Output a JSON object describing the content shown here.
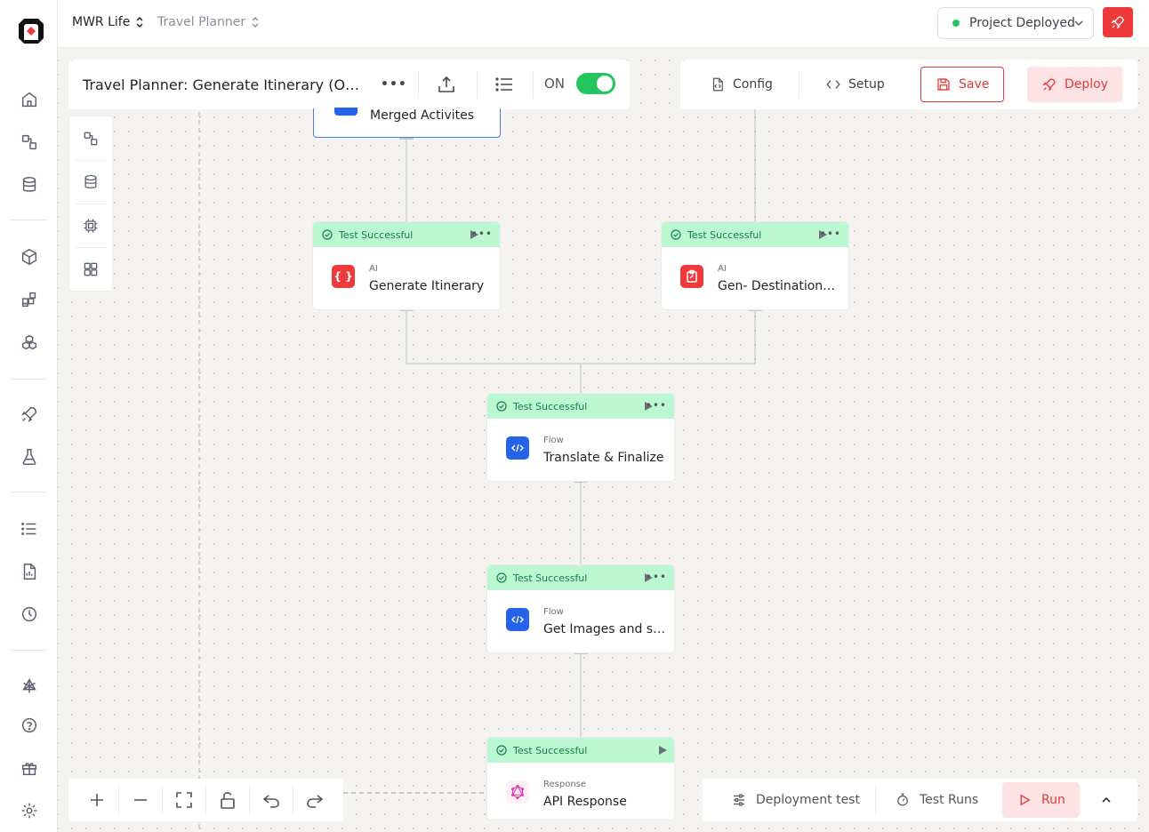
{
  "header": {
    "workspace": "MWR Life",
    "project": "Travel Planner",
    "status": "Project Deployed",
    "status_color": "#22c55e"
  },
  "flow": {
    "title": "Travel Planner: Generate Itinerary (Optim…",
    "toggle_label": "ON",
    "toggle_on": true
  },
  "toolbar": {
    "config": "Config",
    "setup": "Setup",
    "save": "Save",
    "deploy": "Deploy"
  },
  "nodes": {
    "merged": {
      "name": "Merged Activites"
    },
    "gen_itinerary": {
      "status": "Test Successful",
      "type": "AI",
      "name": "Generate Itinerary"
    },
    "gen_destination": {
      "status": "Test Successful",
      "type": "AI",
      "name": "Gen- Destination…"
    },
    "translate": {
      "status": "Test Successful",
      "type": "Flow",
      "name": "Translate & Finalize"
    },
    "get_images": {
      "status": "Test Successful",
      "type": "Flow",
      "name": "Get Images and set…"
    },
    "response": {
      "status": "Test Successful",
      "type": "Response",
      "name": "API Response"
    }
  },
  "bottom": {
    "deployment_test": "Deployment test",
    "test_runs": "Test Runs",
    "run": "Run"
  },
  "colors": {
    "accent": "#ee3a3a",
    "success_bg": "#bbf7d0",
    "success_text": "#15803d",
    "flow_icon": "#2563eb"
  }
}
